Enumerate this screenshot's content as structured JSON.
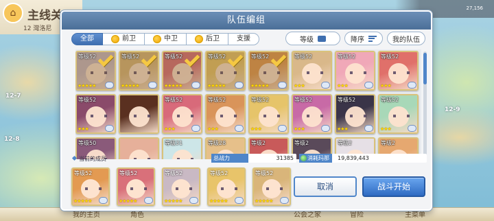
{
  "background": {
    "title": "主线关",
    "subtitle": "12 灣洛尼",
    "stamina": "27,156",
    "nodes": [
      "12-7",
      "12-8",
      "12-9"
    ],
    "bottom_nav": [
      "我的主页",
      "角色",
      "公会之家",
      "冒险",
      "主菜单"
    ]
  },
  "modal": {
    "title": "队伍编组",
    "tabs": [
      {
        "label": "全部",
        "active": true
      },
      {
        "label": "前卫",
        "active": false
      },
      {
        "label": "中卫",
        "active": false
      },
      {
        "label": "后卫",
        "active": false
      },
      {
        "label": "支援",
        "active": false
      }
    ],
    "sort": {
      "level": "等级",
      "order": "降序",
      "my_team": "我的队伍"
    },
    "grid_rows": [
      [
        {
          "lvl": "等级52",
          "stars": "★★★★★",
          "selected": true,
          "color": "#c9b9c4"
        },
        {
          "lvl": "等级52",
          "stars": "★★★★★",
          "selected": true,
          "color": "#d9b57a"
        },
        {
          "lvl": "等级52",
          "stars": "★★★★★",
          "selected": true,
          "color": "#d9707a"
        },
        {
          "lvl": "等级52",
          "stars": "★★★★★",
          "selected": true,
          "color": "#e8c46a"
        },
        {
          "lvl": "等级52",
          "stars": "★★★★★",
          "selected": true,
          "color": "#e39a52"
        },
        {
          "lvl": "等级52",
          "stars": "★★★",
          "selected": false,
          "color": "#d9b88a"
        },
        {
          "lvl": "等级52",
          "stars": "★★★",
          "selected": false,
          "color": "#f0a8b8"
        },
        {
          "lvl": "等级52",
          "stars": "★★★",
          "selected": false,
          "color": "#e0706a"
        }
      ],
      [
        {
          "lvl": "等级52",
          "stars": "★★★",
          "selected": false,
          "color": "#8a4a6a"
        },
        {
          "lvl": "",
          "stars": "",
          "selected": false,
          "color": "#5a3020"
        },
        {
          "lvl": "等级52",
          "stars": "★★★",
          "selected": false,
          "color": "#d86a7a"
        },
        {
          "lvl": "等级52",
          "stars": "★★★",
          "selected": false,
          "color": "#d9945a"
        },
        {
          "lvl": "等级52",
          "stars": "★★★",
          "selected": false,
          "color": "#e6c46a"
        },
        {
          "lvl": "等级52",
          "stars": "★★★",
          "selected": false,
          "color": "#c86aa6"
        },
        {
          "lvl": "等级52",
          "stars": "★★★",
          "selected": false,
          "color": "#3a3448"
        },
        {
          "lvl": "等级52",
          "stars": "★★★",
          "selected": false,
          "color": "#a8d8b8"
        }
      ],
      [
        {
          "lvl": "等级50",
          "stars": "",
          "selected": false,
          "color": "#8a5a7a"
        },
        {
          "lvl": "",
          "stars": "",
          "selected": false,
          "color": "#e6b09a"
        },
        {
          "lvl": "等级31",
          "stars": "",
          "selected": false,
          "color": "#cde6e8"
        },
        {
          "lvl": "等级28",
          "stars": "",
          "selected": false,
          "color": "#e6c08a"
        },
        {
          "lvl": "等级2",
          "stars": "",
          "selected": false,
          "color": "#c85a5a"
        },
        {
          "lvl": "等级2",
          "stars": "",
          "selected": false,
          "color": "#5a4a5a"
        },
        {
          "lvl": "等级2",
          "stars": "",
          "selected": false,
          "color": "#e6e0e6"
        },
        {
          "lvl": "等级2",
          "stars": "",
          "selected": false,
          "color": "#e6a870"
        }
      ]
    ],
    "party": {
      "label": "当前的成员",
      "power_label": "总战力",
      "power_value": "31385",
      "mana_label": "消耗玛那",
      "mana_value": "19,839,443",
      "members": [
        {
          "lvl": "等级52",
          "stars": "★★★★★",
          "color": "#e39a52"
        },
        {
          "lvl": "等级52",
          "stars": "★★★★★",
          "color": "#d9707a"
        },
        {
          "lvl": "等级52",
          "stars": "★★★★★",
          "color": "#c9b9c4"
        },
        {
          "lvl": "等级52",
          "stars": "★★★★★",
          "color": "#e8c46a"
        },
        {
          "lvl": "等级52",
          "stars": "★★★★★",
          "color": "#d9b57a"
        }
      ]
    },
    "buttons": {
      "cancel": "取消",
      "start": "战斗开始"
    }
  },
  "colors": {
    "accent": "#4f86c9",
    "header": "#5a7fa8",
    "gold": "#f5c842"
  }
}
